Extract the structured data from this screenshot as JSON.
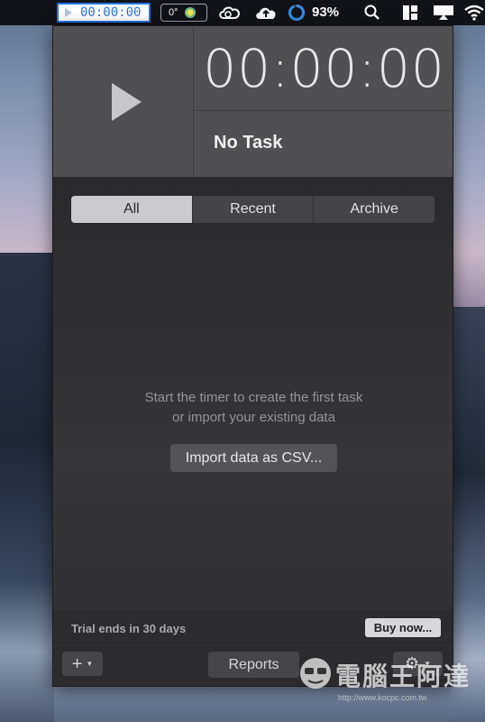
{
  "menubar": {
    "timer_text": "00:00:00",
    "temp_text": "0°",
    "battery_text": "93%",
    "icons": [
      "play-icon",
      "creative-cloud-icon",
      "cloud-upload-icon",
      "battery-ring-icon",
      "search-icon",
      "layout-icon",
      "airplay-icon",
      "wifi-icon"
    ]
  },
  "header": {
    "timer": "00:00:00",
    "task_name": "No Task"
  },
  "tabs": [
    {
      "label": "All",
      "active": true
    },
    {
      "label": "Recent",
      "active": false
    },
    {
      "label": "Archive",
      "active": false
    }
  ],
  "empty_state": {
    "line1": "Start the timer to create the first task",
    "line2": "or import your existing data",
    "import_label": "Import data as CSV..."
  },
  "trial": {
    "text": "Trial ends in 30 days",
    "buy_label": "Buy now..."
  },
  "footer": {
    "add_label": "+",
    "reports_label": "Reports",
    "settings_icon": "gear-icon"
  },
  "watermark": {
    "text": "電腦王阿達",
    "url": "http://www.kocpc.com.tw"
  }
}
